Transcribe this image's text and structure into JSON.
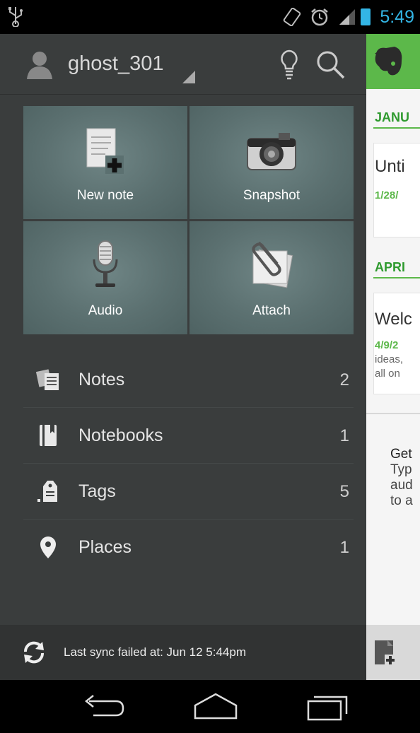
{
  "status_bar": {
    "time": "5:49",
    "icons": [
      "usb-icon",
      "rotate-icon",
      "alarm-icon",
      "signal-icon",
      "battery-icon"
    ],
    "accent_color": "#33b5e5"
  },
  "drawer": {
    "username": "ghost_301",
    "header_icons": [
      "lightbulb-icon",
      "search-icon"
    ],
    "tiles": [
      {
        "label": "New note",
        "icon": "new-note-icon"
      },
      {
        "label": "Snapshot",
        "icon": "camera-icon"
      },
      {
        "label": "Audio",
        "icon": "microphone-icon"
      },
      {
        "label": "Attach",
        "icon": "paperclip-icon"
      }
    ],
    "nav_items": [
      {
        "label": "Notes",
        "count": "2",
        "icon": "notes-icon"
      },
      {
        "label": "Notebooks",
        "count": "1",
        "icon": "notebook-icon"
      },
      {
        "label": "Tags",
        "count": "5",
        "icon": "tag-icon"
      },
      {
        "label": "Places",
        "count": "1",
        "icon": "location-pin-icon"
      }
    ],
    "sync_status": "Last sync failed at: Jun 12 5:44pm"
  },
  "main_view": {
    "brand_color": "#5cb84a",
    "sections": [
      {
        "header": "JANU",
        "title": "Unti",
        "date": "1/28/",
        "snippet": []
      },
      {
        "header": "APRI",
        "title": "Welc",
        "date": "4/9/2",
        "snippet": [
          "ideas,",
          "all on"
        ]
      }
    ],
    "getting_started": [
      "Get",
      "Typ",
      "aud",
      "to a"
    ]
  },
  "nav_bar": {
    "buttons": [
      "back-icon",
      "home-icon",
      "recent-apps-icon"
    ]
  }
}
